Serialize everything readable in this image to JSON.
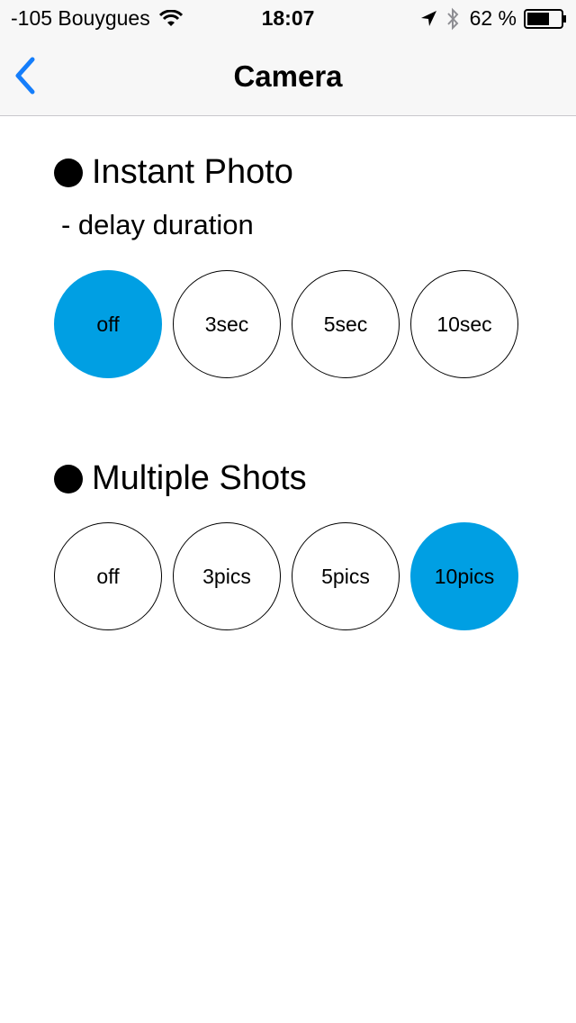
{
  "status_bar": {
    "carrier": "-105 Bouygues",
    "time": "18:07",
    "battery": "62 %"
  },
  "nav": {
    "title": "Camera",
    "back_icon": "chevron-left-icon"
  },
  "instant_photo": {
    "heading": "Instant Photo",
    "sublabel": "- delay duration",
    "options": [
      "off",
      "3sec",
      "5sec",
      "10sec"
    ],
    "selected": "off"
  },
  "multiple_shots": {
    "heading": "Multiple Shots",
    "options": [
      "off",
      "3pics",
      "5pics",
      "10pics"
    ],
    "selected": "10pics"
  },
  "colors": {
    "accent": "#009fe3",
    "ios_blue": "#157efb"
  }
}
